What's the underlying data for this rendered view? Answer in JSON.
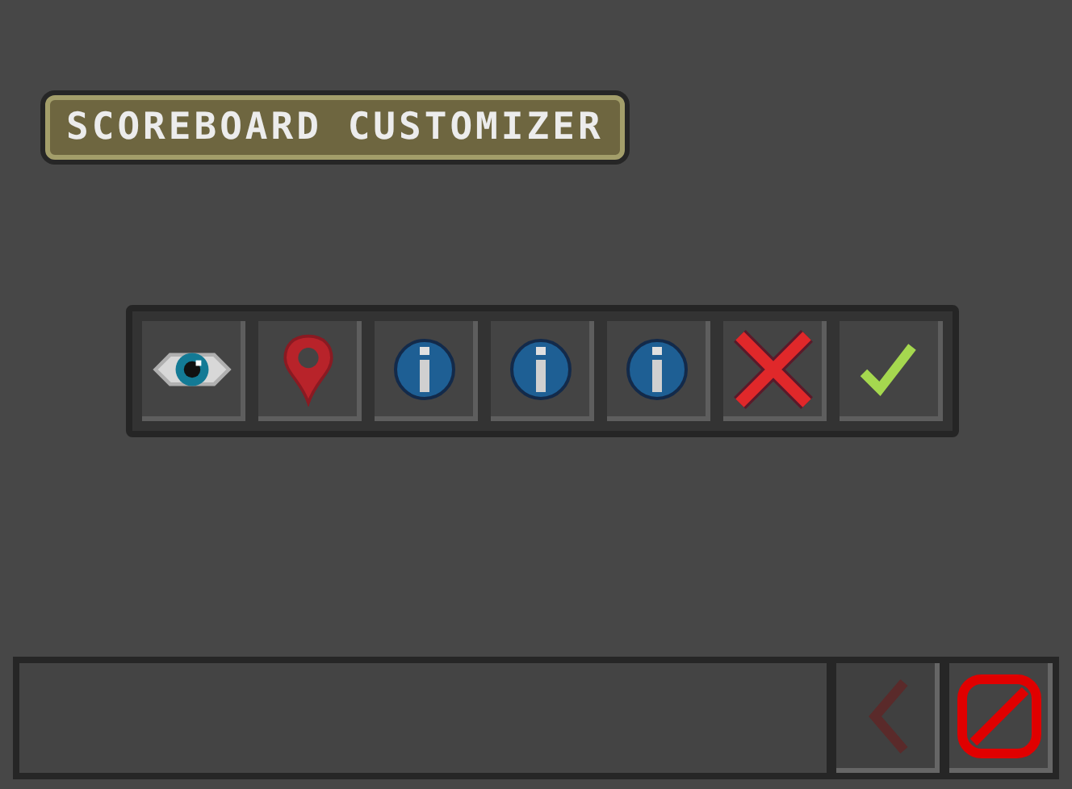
{
  "title": "SCOREBOARD CUSTOMIZER",
  "slots": [
    {
      "kind": "eye"
    },
    {
      "kind": "pin"
    },
    {
      "kind": "info"
    },
    {
      "kind": "info"
    },
    {
      "kind": "info"
    },
    {
      "kind": "cross"
    },
    {
      "kind": "check"
    }
  ],
  "footer": {
    "buttons": [
      {
        "kind": "back",
        "disabled": true
      },
      {
        "kind": "cancel",
        "disabled": false
      }
    ]
  }
}
